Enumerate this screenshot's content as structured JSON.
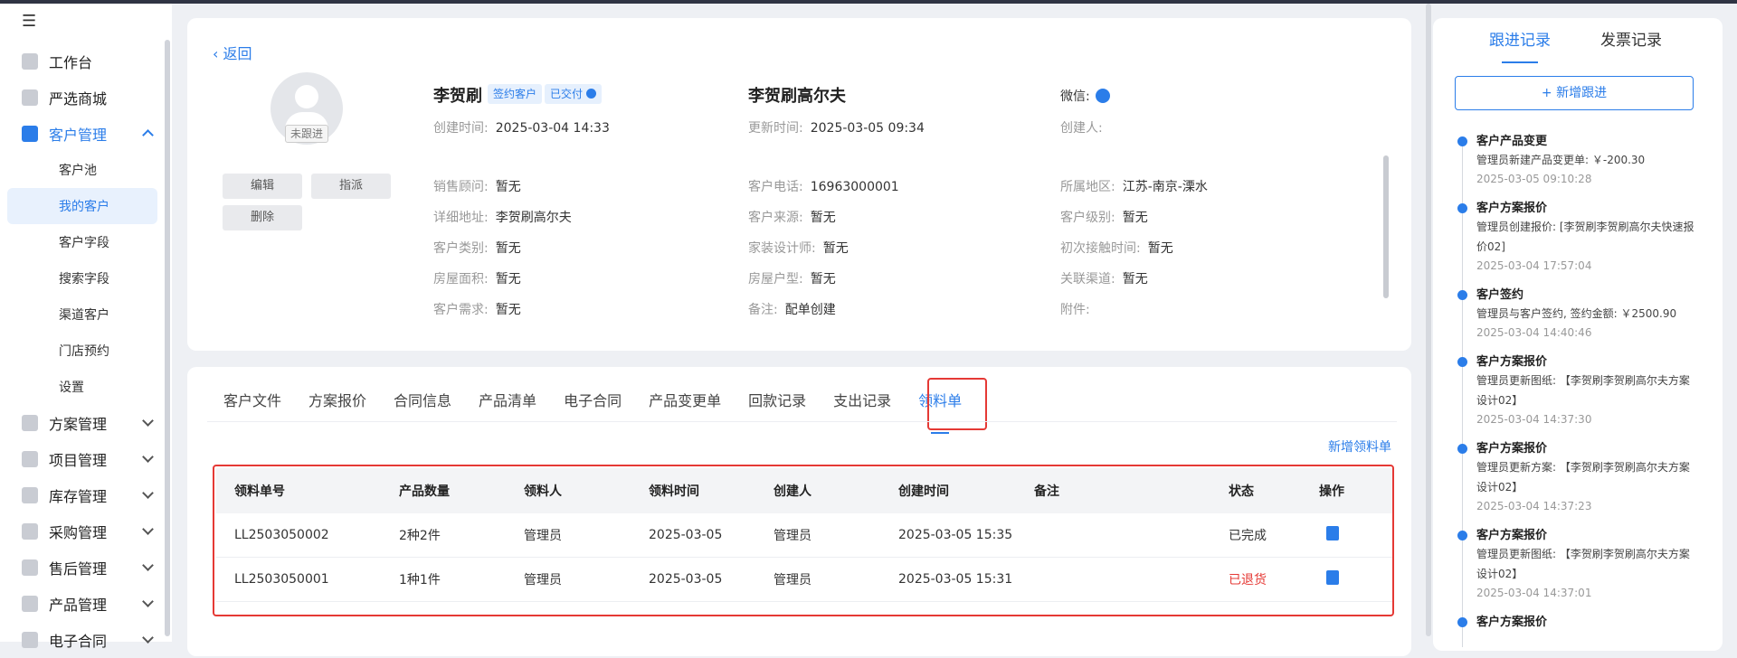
{
  "sidebar": {
    "items": [
      {
        "label": "工作台",
        "icon": "workbench-icon"
      },
      {
        "label": "严选商城",
        "icon": "mall-icon"
      },
      {
        "label": "客户管理",
        "icon": "customer-icon"
      },
      {
        "label": "方案管理",
        "icon": "plan-icon"
      },
      {
        "label": "项目管理",
        "icon": "project-icon"
      },
      {
        "label": "库存管理",
        "icon": "inventory-icon"
      },
      {
        "label": "采购管理",
        "icon": "purchase-icon"
      },
      {
        "label": "售后管理",
        "icon": "aftersales-icon"
      },
      {
        "label": "产品管理",
        "icon": "product-icon"
      },
      {
        "label": "电子合同",
        "icon": "contract-icon"
      }
    ],
    "sub_items": [
      "客户池",
      "我的客户",
      "客户字段",
      "搜索字段",
      "渠道客户",
      "门店预约",
      "设置"
    ]
  },
  "header": {
    "back": "返回",
    "follow_status": "未跟进",
    "buttons": {
      "edit": "编辑",
      "assign": "指派",
      "delete": "删除"
    },
    "customer_name": "李贺刷",
    "tag_signed": "签约客户",
    "tag_delivered": "已交付",
    "project_name": "李贺刷高尔夫",
    "wechat_label": "微信:",
    "created_label": "创建时间:",
    "created_value": "2025-03-04 14:33",
    "updated_label": "更新时间:",
    "updated_value": "2025-03-05 09:34",
    "creator_label": "创建人:"
  },
  "fields": [
    {
      "label": "销售顾问:",
      "value": "暂无"
    },
    {
      "label": "客户电话:",
      "value": "16963000001"
    },
    {
      "label": "所属地区:",
      "value": "江苏-南京-溧水"
    },
    {
      "label": "详细地址:",
      "value": "李贺刷高尔夫"
    },
    {
      "label": "客户来源:",
      "value": "暂无"
    },
    {
      "label": "客户级别:",
      "value": "暂无"
    },
    {
      "label": "客户类别:",
      "value": "暂无"
    },
    {
      "label": "家装设计师:",
      "value": "暂无"
    },
    {
      "label": "初次接触时间:",
      "value": "暂无"
    },
    {
      "label": "房屋面积:",
      "value": "暂无"
    },
    {
      "label": "房屋户型:",
      "value": "暂无"
    },
    {
      "label": "关联渠道:",
      "value": "暂无"
    },
    {
      "label": "客户需求:",
      "value": "暂无"
    },
    {
      "label": "备注:",
      "value": "配单创建"
    },
    {
      "label": "附件:",
      "value": ""
    }
  ],
  "tabs": [
    "客户文件",
    "方案报价",
    "合同信息",
    "产品清单",
    "电子合同",
    "产品变更单",
    "回款记录",
    "支出记录",
    "领料单"
  ],
  "new_material_btn": "新增领料单",
  "table": {
    "headers": [
      "领料单号",
      "产品数量",
      "领料人",
      "领料时间",
      "创建人",
      "创建时间",
      "备注",
      "状态",
      "操作"
    ],
    "rows": [
      {
        "no": "LL2503050002",
        "qty": "2种2件",
        "receiver": "管理员",
        "date": "2025-03-05",
        "creator": "管理员",
        "created": "2025-03-05 15:35",
        "note": "",
        "status": "已完成"
      },
      {
        "no": "LL2503050001",
        "qty": "1种1件",
        "receiver": "管理员",
        "date": "2025-03-05",
        "creator": "管理员",
        "created": "2025-03-05 15:31",
        "note": "",
        "status": "已退货"
      }
    ]
  },
  "right_panel": {
    "tabs": [
      "跟进记录",
      "发票记录"
    ],
    "add_btn": "+ 新增跟进",
    "timeline": [
      {
        "title": "客户产品变更",
        "desc": "管理员新建产品变更单: ￥-200.30",
        "time": "2025-03-05 09:10:28"
      },
      {
        "title": "客户方案报价",
        "desc": "管理员创建报价: [李贺刷李贺刷高尔夫快速报价02]",
        "time": "2025-03-04 17:57:04"
      },
      {
        "title": "客户签约",
        "desc": "管理员与客户签约, 签约金额: ￥2500.90",
        "time": "2025-03-04 14:40:46"
      },
      {
        "title": "客户方案报价",
        "desc": "管理员更新图纸: 【李贺刷李贺刷高尔夫方案设计02】",
        "time": "2025-03-04 14:37:30"
      },
      {
        "title": "客户方案报价",
        "desc": "管理员更新方案: 【李贺刷李贺刷高尔夫方案设计02】",
        "time": "2025-03-04 14:37:23"
      },
      {
        "title": "客户方案报价",
        "desc": "管理员更新图纸: 【李贺刷李贺刷高尔夫方案设计02】",
        "time": "2025-03-04 14:37:01"
      },
      {
        "title": "客户方案报价",
        "desc": "",
        "time": ""
      }
    ]
  },
  "colors": {
    "accent": "#2b7de9",
    "highlight": "#e53935",
    "returned": "#e53935"
  }
}
